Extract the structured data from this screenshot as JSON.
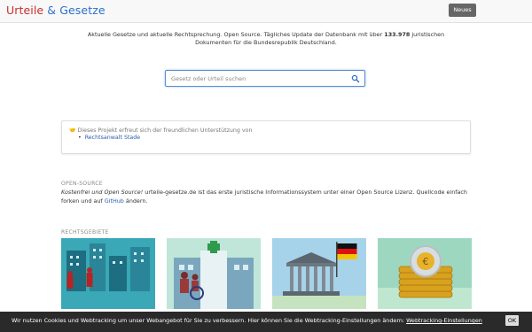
{
  "navbar": {
    "brand_part1": "Urteile",
    "brand_part2": "& Gesetze",
    "news_button": "Neues"
  },
  "intro": {
    "text_before": "Aktuelle Gesetze und aktuelle Rechtsprechung. Open Source. Tägliches Update der Datenbank mit über ",
    "count": "133.978",
    "text_after": " juristischen Dokumenten für die Bundesrepublik Deutschland."
  },
  "search": {
    "placeholder": "Gesetz oder Urteil suchen",
    "icon": "search-icon"
  },
  "sponsor": {
    "text": "Dieses Projekt erfreut sich der freundlichen Unterstützung von",
    "link": "Rechtsanwalt Stade",
    "icon": "handshake-icon"
  },
  "open_source": {
    "title": "OPEN-SOURCE",
    "emphasis": "Kostenfrei und Open Source!",
    "text_mid": " urteile-gesetze.de ist das erste juristische Informationssystem unter einer Open Source Lizenz. Quellcode einfach forken und auf ",
    "github_link": "GitHub",
    "text_end": " ändern."
  },
  "rechtsgebiete": {
    "title": "RECHTSGEBIETE",
    "tiles": [
      {
        "icon": "city-people-illustration"
      },
      {
        "icon": "hospital-wheelchair-illustration"
      },
      {
        "icon": "government-building-flag-illustration"
      },
      {
        "icon": "euro-coins-illustration"
      }
    ]
  },
  "cookie": {
    "text": "Wir nutzen Cookies und Webtracking um unser Webangebot für Sie zu verbessern. Hier können Sie die Webtracking-Einstellungen ändern: ",
    "link": "Webtracking-Einstellungen",
    "ok": "OK"
  },
  "colors": {
    "brand_red": "#c9302c",
    "brand_blue": "#2a6fc9",
    "link_blue": "#2a5db0",
    "cookie_bg": "#2a2a2a"
  }
}
